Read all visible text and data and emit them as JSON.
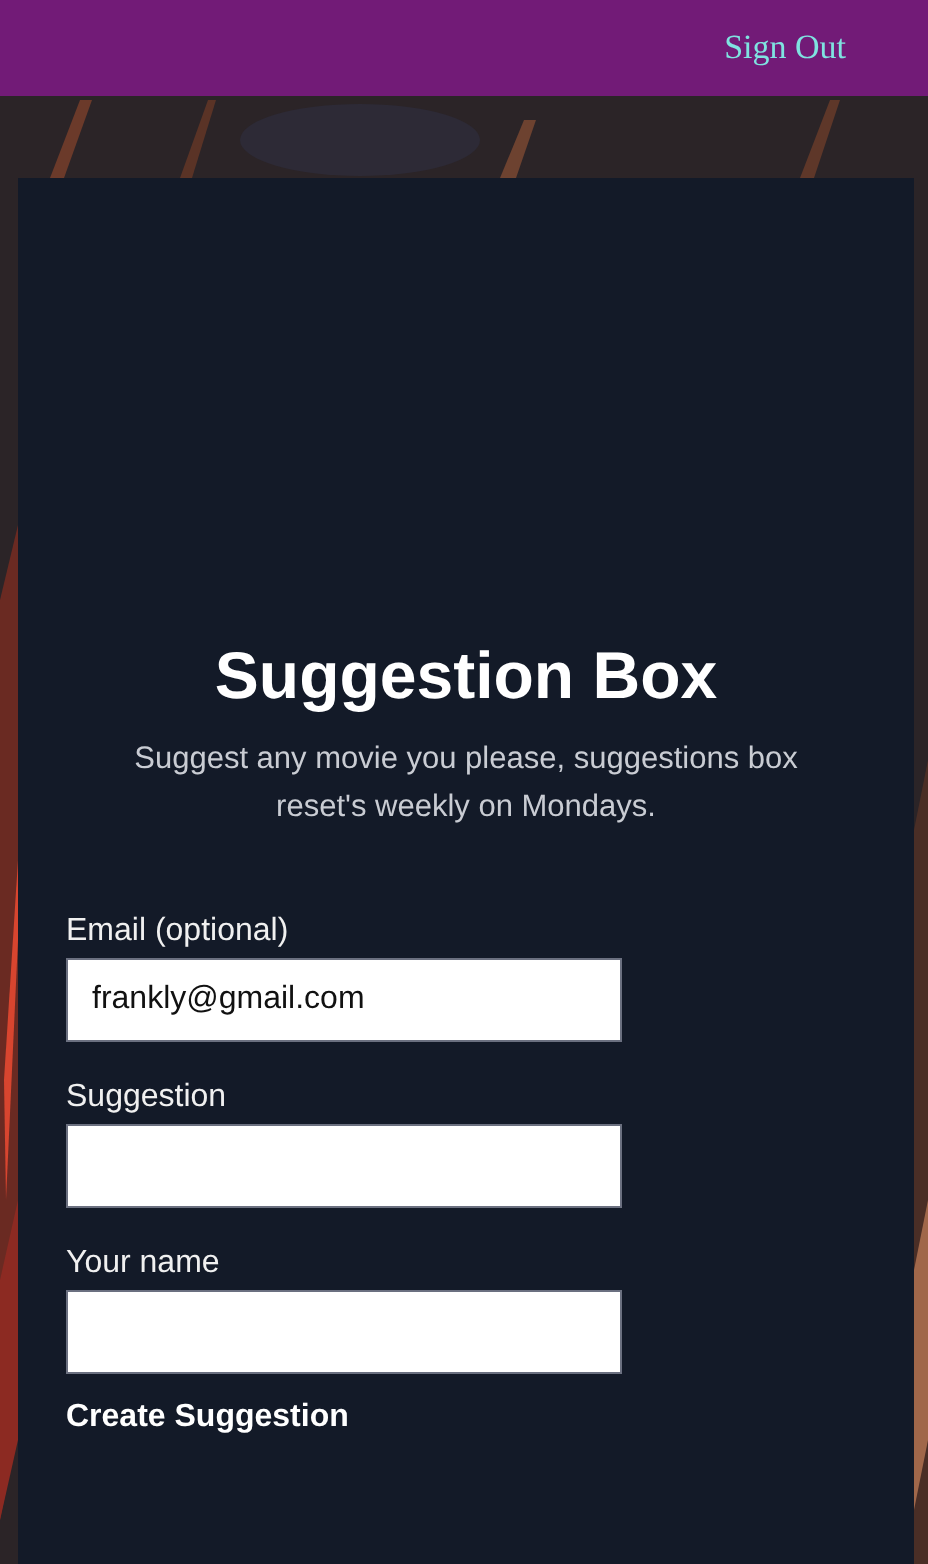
{
  "navbar": {
    "link": "Sign Out"
  },
  "form": {
    "title": "Suggestion Box",
    "subtitle": "Suggest any movie you please, suggestions box reset's weekly on Mondays.",
    "fields": [
      {
        "label": "Email (optional)",
        "value": "frankly@gmail.com"
      },
      {
        "label": "Suggestion"
      },
      {
        "label": "Your name"
      }
    ],
    "submit": "Create Suggestion"
  }
}
